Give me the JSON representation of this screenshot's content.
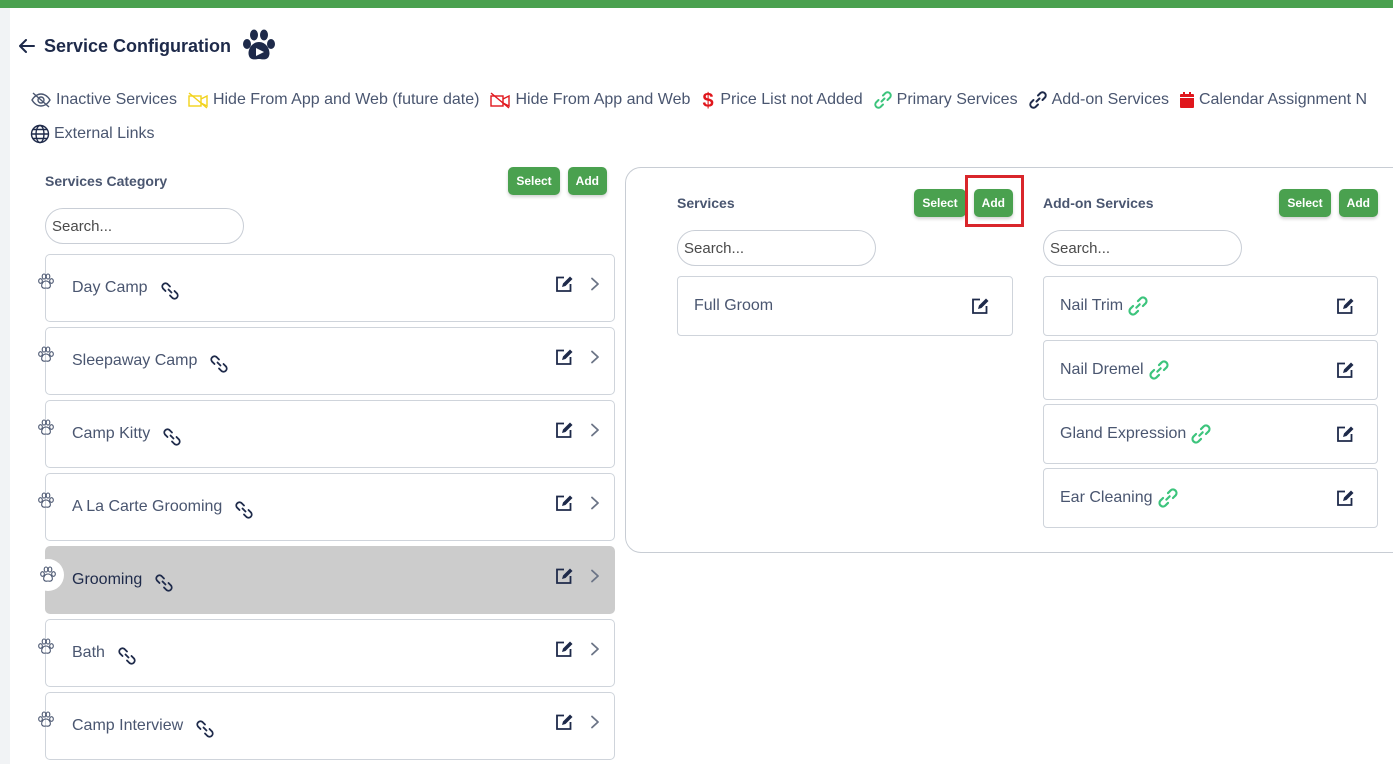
{
  "header": {
    "title": "Service Configuration",
    "back_icon": "arrow-left-icon",
    "logo_icon": "paw-play-logo-icon"
  },
  "colors": {
    "brand_green": "#4aa14f",
    "navy": "#1e2a4a",
    "primary_link": "#3cc47c",
    "danger": "#e0161c",
    "highlight": "#d9262b",
    "selected_row": "#cccccc"
  },
  "legend": [
    {
      "label": "Inactive Services",
      "icon": "eye-slash-icon"
    },
    {
      "label": "Hide From App and Web (future date)",
      "icon": "video-slash-yellow-icon"
    },
    {
      "label": "Hide From App and Web",
      "icon": "video-slash-red-icon"
    },
    {
      "label": "Price List not Added",
      "icon": "dollar-icon"
    },
    {
      "label": "Primary Services",
      "icon": "link-green-icon"
    },
    {
      "label": "Add-on Services",
      "icon": "link-navy-icon"
    },
    {
      "label": "Calendar Assignment N",
      "icon": "calendar-icon"
    },
    {
      "label": "External Links",
      "icon": "globe-icon"
    }
  ],
  "categories": {
    "label": "Services Category",
    "select_label": "Select",
    "add_label": "Add",
    "search_placeholder": "Search...",
    "items": [
      {
        "label": "Day Camp"
      },
      {
        "label": "Sleepaway Camp"
      },
      {
        "label": "Camp Kitty"
      },
      {
        "label": "A La Carte Grooming"
      },
      {
        "label": "Grooming",
        "selected": true
      },
      {
        "label": "Bath"
      },
      {
        "label": "Camp Interview"
      }
    ]
  },
  "services": {
    "label": "Services",
    "select_label": "Select",
    "add_label": "Add",
    "search_placeholder": "Search...",
    "items": [
      {
        "label": "Full Groom"
      }
    ]
  },
  "addons": {
    "label": "Add-on Services",
    "select_label": "Select",
    "add_label": "Add",
    "search_placeholder": "Search...",
    "items": [
      {
        "label": "Nail Trim"
      },
      {
        "label": "Nail Dremel"
      },
      {
        "label": "Gland Expression"
      },
      {
        "label": "Ear Cleaning"
      }
    ]
  }
}
